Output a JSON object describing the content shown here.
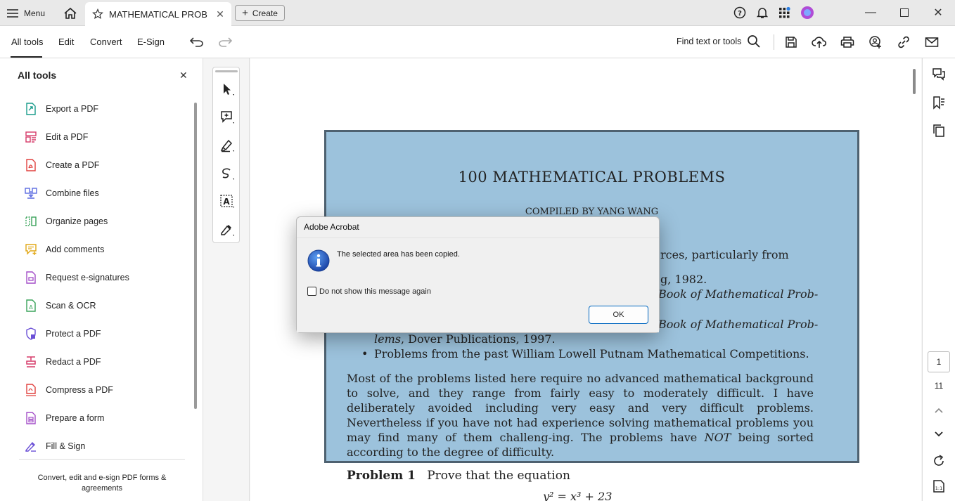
{
  "titlebar": {
    "menu_label": "Menu",
    "tab_title": "MATHEMATICAL PROB...",
    "create_label": "Create",
    "avatar_color": "#b04cd6"
  },
  "toolbar": {
    "tabs": [
      "All tools",
      "Edit",
      "Convert",
      "E-Sign"
    ],
    "find_label": "Find text or tools"
  },
  "left_panel": {
    "title": "All tools",
    "items": [
      {
        "label": "Export a PDF",
        "icon": "export-pdf-icon",
        "color": "#1a9c8c"
      },
      {
        "label": "Edit a PDF",
        "icon": "edit-pdf-icon",
        "color": "#d63b6a"
      },
      {
        "label": "Create a PDF",
        "icon": "create-pdf-icon",
        "color": "#e0413f"
      },
      {
        "label": "Combine files",
        "icon": "combine-files-icon",
        "color": "#5b6be0"
      },
      {
        "label": "Organize pages",
        "icon": "organize-pages-icon",
        "color": "#3aa35a"
      },
      {
        "label": "Add comments",
        "icon": "add-comments-icon",
        "color": "#e2a818"
      },
      {
        "label": "Request e-signatures",
        "icon": "request-esign-icon",
        "color": "#a44fc8"
      },
      {
        "label": "Scan & OCR",
        "icon": "scan-ocr-icon",
        "color": "#3aa35a"
      },
      {
        "label": "Protect a PDF",
        "icon": "protect-pdf-icon",
        "color": "#6a4fd6"
      },
      {
        "label": "Redact a PDF",
        "icon": "redact-pdf-icon",
        "color": "#d63b6a"
      },
      {
        "label": "Compress a PDF",
        "icon": "compress-pdf-icon",
        "color": "#e0413f"
      },
      {
        "label": "Prepare a form",
        "icon": "prepare-form-icon",
        "color": "#a44fc8"
      },
      {
        "label": "Fill & Sign",
        "icon": "fill-sign-icon",
        "color": "#6a4fd6"
      }
    ],
    "footer": "Convert, edit and e-sign PDF forms & agreements"
  },
  "document": {
    "title": "100 MATHEMATICAL PROBLEMS",
    "subtitle": "COMPILED BY YANG WANG",
    "line_sources": "rces, particularly from",
    "line_1982": "g, 1982.",
    "line_book1": "Book of Mathematical Prob-",
    "line_book2": "Book of Mathematical Prob-",
    "line_lems_italic": "lems",
    "line_lems_rest": ", Dover Publications, 1997.",
    "bullet": "•",
    "line_putnam": "Problems from the past William Lowell Putnam Mathematical Competitions.",
    "paragraph_1": "Most of the problems listed here require no advanced mathematical background to solve, and they range from fairly easy to moderately difficult. I have deliberately avoided including very easy and very difficult problems. Nevertheless if you have not had experience solving mathematical problems you may find many of them challeng-ing. The problems have ",
    "paragraph_not": "NOT",
    "paragraph_2": " being sorted according to the degree of difficulty.",
    "problem_label": "Problem 1",
    "problem_text": "Prove that the equation",
    "equation": "y² = x³ + 23"
  },
  "page_nav": {
    "current_page": "1",
    "total_pages": "11"
  },
  "dialog": {
    "title": "Adobe Acrobat",
    "message": "The selected area has been copied.",
    "checkbox_label": "Do not show this message again",
    "ok_label": "OK"
  }
}
